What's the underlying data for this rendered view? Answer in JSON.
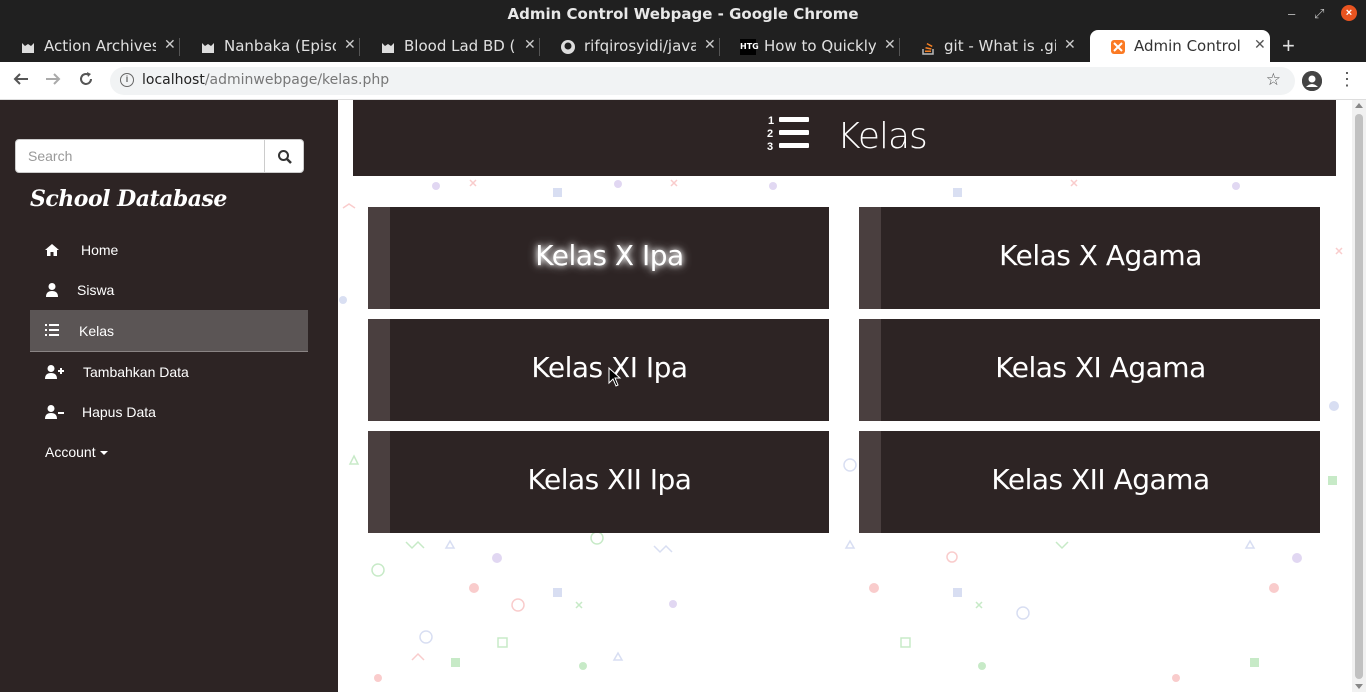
{
  "window": {
    "title": "Admin Control Webpage - Google Chrome",
    "controls": {
      "minimize": "–",
      "maximize": "⤢",
      "close": "×"
    }
  },
  "tabs": [
    {
      "label": "Action Archives |",
      "icon": "cat-icon",
      "active": false
    },
    {
      "label": "Nanbaka (Episod",
      "icon": "cat-icon",
      "active": false
    },
    {
      "label": "Blood Lad BD (E",
      "icon": "cat-icon",
      "active": false
    },
    {
      "label": "rifqirosyidi/java-",
      "icon": "github-icon",
      "active": false
    },
    {
      "label": "How to Quickly R",
      "icon": "htg-icon",
      "active": false
    },
    {
      "label": "git - What is .gitig",
      "icon": "stackoverflow-icon",
      "active": false
    },
    {
      "label": "Admin Control W",
      "icon": "xampp-icon",
      "active": true
    }
  ],
  "tab_favicon_text": {
    "htg": "HTG"
  },
  "address": {
    "host": "localhost",
    "path": "/adminwebpage/kelas.php"
  },
  "sidebar": {
    "search_placeholder": "Search",
    "brand": "School Database",
    "items": [
      {
        "label": "Home",
        "icon": "home-icon",
        "active": false
      },
      {
        "label": "Siswa",
        "icon": "user-icon",
        "active": false
      },
      {
        "label": "Kelas",
        "icon": "list-icon",
        "active": true
      },
      {
        "label": "Tambahkan Data",
        "icon": "user-plus-icon",
        "active": false
      },
      {
        "label": "Hapus Data",
        "icon": "user-minus-icon",
        "active": false
      }
    ],
    "account_label": "Account"
  },
  "main": {
    "title": "Kelas",
    "title_icon": "ordered-list-icon",
    "cards": [
      {
        "label": "Kelas X Ipa",
        "hover": true
      },
      {
        "label": "Kelas X Agama",
        "hover": false
      },
      {
        "label": "Kelas XI Ipa",
        "hover": false
      },
      {
        "label": "Kelas XI Agama",
        "hover": false
      },
      {
        "label": "Kelas XII Ipa",
        "hover": false
      },
      {
        "label": "Kelas XII Agama",
        "hover": false
      }
    ]
  },
  "colors": {
    "sidebar_bg": "#2d2424",
    "card_bg": "#2d2424",
    "card_stripe": "#4a3f3f",
    "active_item_bg": "#5b5555",
    "chrome_dark": "#202020"
  }
}
